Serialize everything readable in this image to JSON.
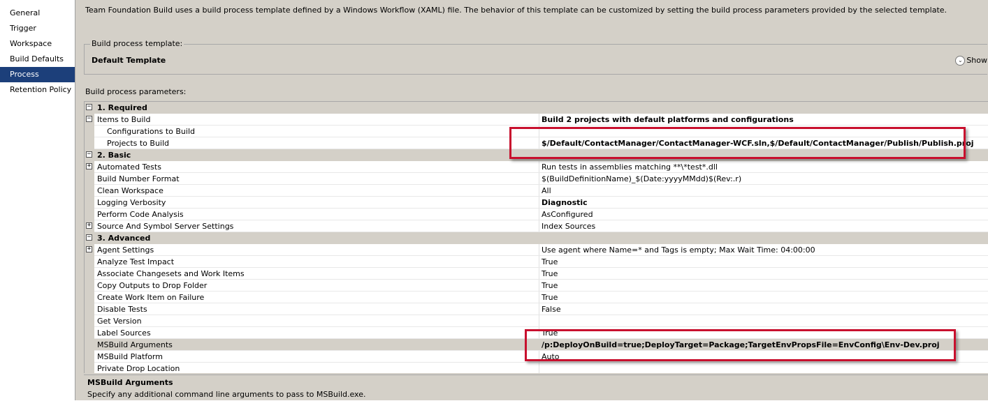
{
  "nav": {
    "items": [
      {
        "label": "General",
        "selected": false
      },
      {
        "label": "Trigger",
        "selected": false
      },
      {
        "label": "Workspace",
        "selected": false
      },
      {
        "label": "Build Defaults",
        "selected": false
      },
      {
        "label": "Process",
        "selected": true
      },
      {
        "label": "Retention Policy",
        "selected": false
      }
    ]
  },
  "main": {
    "description": "Team Foundation Build uses a build process template defined by a Windows Workflow (XAML) file. The behavior of this template can be customized by setting the build process parameters provided by the selected template.",
    "template_group_label": "Build process template:",
    "template_name": "Default Template",
    "show_label": "Show",
    "params_label": "Build process parameters:"
  },
  "grid": {
    "rows": [
      {
        "kind": "cat",
        "label": "1. Required",
        "expander": "−"
      },
      {
        "kind": "param",
        "name": "Items to Build",
        "value": "Build 2 projects with default platforms and configurations",
        "bold": true,
        "expander": "−"
      },
      {
        "kind": "param",
        "name": "Configurations to Build",
        "value": "",
        "child": true
      },
      {
        "kind": "param",
        "name": "Projects to Build",
        "value": "$/Default/ContactManager/ContactManager-WCF.sln,$/Default/ContactManager/Publish/Publish.proj",
        "bold": true,
        "child": true
      },
      {
        "kind": "cat",
        "label": "2. Basic",
        "expander": "−"
      },
      {
        "kind": "param",
        "name": "Automated Tests",
        "value": "Run tests in assemblies matching **\\*test*.dll",
        "expander": "+"
      },
      {
        "kind": "param",
        "name": "Build Number Format",
        "value": "$(BuildDefinitionName)_$(Date:yyyyMMdd)$(Rev:.r)"
      },
      {
        "kind": "param",
        "name": "Clean Workspace",
        "value": "All"
      },
      {
        "kind": "param",
        "name": "Logging Verbosity",
        "value": "Diagnostic",
        "bold": true
      },
      {
        "kind": "param",
        "name": "Perform Code Analysis",
        "value": "AsConfigured"
      },
      {
        "kind": "param",
        "name": "Source And Symbol Server Settings",
        "value": "Index Sources",
        "expander": "+"
      },
      {
        "kind": "cat",
        "label": "3. Advanced",
        "expander": "−"
      },
      {
        "kind": "param",
        "name": "Agent Settings",
        "value": "Use agent where Name=* and Tags is empty; Max Wait Time: 04:00:00",
        "expander": "+"
      },
      {
        "kind": "param",
        "name": "Analyze Test Impact",
        "value": "True"
      },
      {
        "kind": "param",
        "name": "Associate Changesets and Work Items",
        "value": "True"
      },
      {
        "kind": "param",
        "name": "Copy Outputs to Drop Folder",
        "value": "True"
      },
      {
        "kind": "param",
        "name": "Create Work Item on Failure",
        "value": "True"
      },
      {
        "kind": "param",
        "name": "Disable Tests",
        "value": "False"
      },
      {
        "kind": "param",
        "name": "Get Version",
        "value": ""
      },
      {
        "kind": "param",
        "name": "Label Sources",
        "value": "True"
      },
      {
        "kind": "param",
        "name": "MSBuild Arguments",
        "value": "/p:DeployOnBuild=true;DeployTarget=Package;TargetEnvPropsFile=EnvConfig\\Env-Dev.proj",
        "bold": true,
        "selected": true
      },
      {
        "kind": "param",
        "name": "MSBuild Platform",
        "value": "Auto"
      },
      {
        "kind": "param",
        "name": "Private Drop Location",
        "value": ""
      }
    ]
  },
  "help": {
    "title": "MSBuild Arguments",
    "text": "Specify any additional command line arguments to pass to MSBuild.exe."
  },
  "colors": {
    "selection": "#1c3f7a",
    "panel": "#d4d0c8",
    "highlight": "#c8102e"
  }
}
